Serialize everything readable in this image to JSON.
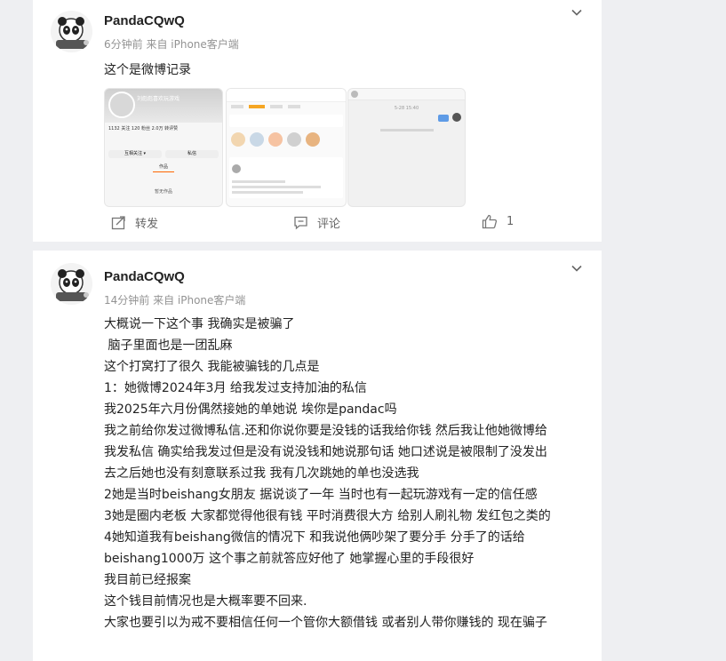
{
  "posts": [
    {
      "username": "PandaCQwQ",
      "meta": "6分钟前  来自 iPhone客户端",
      "text": "这个是微博记录",
      "actions": {
        "repost": "转发",
        "comment": "评论",
        "like_count": "1"
      }
    },
    {
      "username": "PandaCQwQ",
      "meta": "14分钟前  来自 iPhone客户端",
      "lines": [
        "大概说一下这个事 我确实是被骗了",
        " 脑子里面也是一团乱麻",
        "这个打窝打了很久 我能被骗钱的几点是",
        "1：她微博2024年3月 给我发过支持加油的私信",
        "我2025年六月份偶然接她的单她说 埃你是pandac吗",
        "我之前给你发过微博私信.还和你说你要是没钱的话我给你钱 然后我让他她微博给",
        "我发私信 确实给我发过但是没有说没钱和她说那句话 她口述说是被限制了没发出",
        "去之后她也没有刻意联系过我 我有几次跳她的单也没选我",
        "2她是当时beishang女朋友 据说谈了一年 当时也有一起玩游戏有一定的信任感",
        "3她是圈内老板 大家都觉得他很有钱 平时消费很大方 给别人刷礼物 发红包之类的",
        "4她知道我有beishang微信的情况下 和我说他俩吵架了要分手 分手了的话给",
        "beishang1000万 这个事之前就答应好他了 她掌握心里的手段很好",
        "我目前已经报案",
        "这个钱目前情况也是大概率要不回来.",
        "大家也要引以为戒不要相信任何一个管你大额借钱 或者别人带你赚钱的 现在骗子"
      ]
    }
  ],
  "thumbnails": {
    "profile": {
      "name": "刘彪彪喜欢玩游戏",
      "stats": "1132 关注   120 粉丝   2.0万 转评赞",
      "follow_btn": "互相关注 ▾",
      "msg_btn": "私信",
      "tab": "作品",
      "empty": "暂无作品"
    },
    "chat": {
      "date": "5-28 15:40"
    }
  },
  "colors": {
    "card_bg": "#ffffff",
    "page_bg": "#eeeff2",
    "meta": "#939393",
    "icon": "#777777"
  }
}
